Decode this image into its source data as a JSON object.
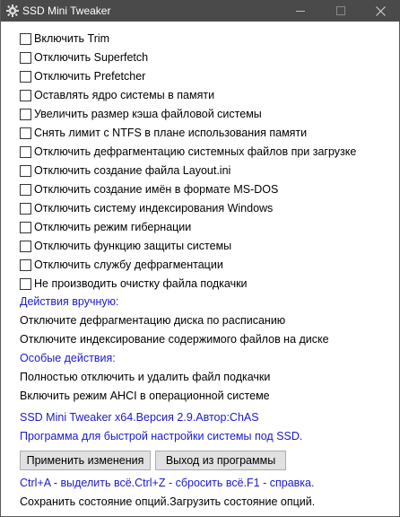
{
  "window": {
    "title": "SSD Mini Tweaker",
    "colors": {
      "titlebar": "#4a4a4a",
      "link_blue": "#1a1acc",
      "button_face": "#e1e1e1"
    }
  },
  "options": [
    {
      "label": "Включить Trim",
      "checked": false
    },
    {
      "label": "Отключить Superfetch",
      "checked": false
    },
    {
      "label": "Отключить Prefetcher",
      "checked": false
    },
    {
      "label": "Оставлять ядро системы в памяти",
      "checked": false
    },
    {
      "label": "Увеличить размер кэша файловой системы",
      "checked": false
    },
    {
      "label": "Снять лимит с NTFS в плане использования памяти",
      "checked": false
    },
    {
      "label": "Отключить дефрагментацию системных файлов при загрузке",
      "checked": false
    },
    {
      "label": "Отключить создание файла Layout.ini",
      "checked": false
    },
    {
      "label": "Отключить создание имён в формате MS-DOS",
      "checked": false
    },
    {
      "label": "Отключить систему индексирования Windows",
      "checked": false
    },
    {
      "label": "Отключить режим гибернации",
      "checked": false
    },
    {
      "label": "Отключить функцию защиты системы",
      "checked": false
    },
    {
      "label": "Отключить службу дефрагментации",
      "checked": false
    },
    {
      "label": "Не производить очистку файла подкачки",
      "checked": false
    }
  ],
  "manual": {
    "heading": "Действия вручную:",
    "items": [
      "Отключите дефрагментацию диска по расписанию",
      "Отключите индексирование содержимого файлов на диске"
    ]
  },
  "special": {
    "heading": "Особые действия:",
    "items": [
      "Полностью отключить и удалить файл подкачки",
      "Включить режим AHCI в операционной системе"
    ]
  },
  "info": {
    "version_line": "SSD Mini Tweaker x64.Версия 2.9.Автор:ChAS",
    "description": "Программа для быстрой настройки системы под SSD."
  },
  "buttons": {
    "apply": "Применить изменения",
    "exit": "Выход из программы"
  },
  "footer": {
    "shortcuts": "Ctrl+A - выделить всё.Ctrl+Z - сбросить всё.F1 - справка.",
    "state": "Сохранить состояние опций.Загрузить состояние опций."
  }
}
